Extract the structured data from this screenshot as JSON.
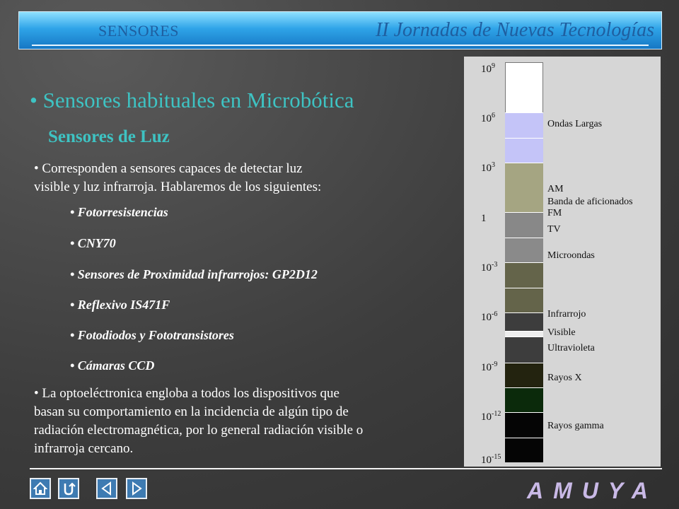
{
  "header": {
    "section": "SENSORES",
    "event": "II Jornadas de Nuevas Tecnologías"
  },
  "heading": "• Sensores habituales en Microbótica",
  "subheading": "Sensores de Luz",
  "intro_line1": "• Corresponden a sensores capaces de detectar luz",
  "intro_line2": "visible y luz infrarroja. Hablaremos de los siguientes:",
  "items": [
    "• Fotorresistencias",
    "• CNY70",
    "• Sensores de Proximidad infrarrojos: GP2D12",
    "• Reflexivo  IS471F",
    "• Fotodiodos y Fototransistores",
    "• Cámaras CCD"
  ],
  "conclusion": [
    "• La optoeléctronica engloba a todos los dispositivos que",
    "basan su comportamiento en la incidencia de algún tipo de",
    "radiación electromagnética, por lo general radiación visible o",
    "infrarroja cercano."
  ],
  "spectrum": {
    "ticks": [
      {
        "base": "10",
        "exp": "9"
      },
      {
        "base": "10",
        "exp": "6"
      },
      {
        "base": "10",
        "exp": "3"
      },
      {
        "base": "1",
        "exp": ""
      },
      {
        "base": "10",
        "exp": "-3"
      },
      {
        "base": "10",
        "exp": "-6"
      },
      {
        "base": "10",
        "exp": "-9"
      },
      {
        "base": "10",
        "exp": "-12"
      },
      {
        "base": "10",
        "exp": "-15"
      }
    ],
    "labels": [
      "Ondas Largas",
      "AM",
      "Banda de aficionados",
      "FM",
      "TV",
      "Microondas",
      "Infrarrojo",
      "Visible",
      "Ultravioleta",
      "Rayos X",
      "Rayos gamma"
    ],
    "colors": {
      "ondas_largas": "#c4c4f8",
      "am": "#a5a582",
      "fm_tv": "#888888",
      "microondas": "#8a8a8a",
      "infrarrojo": "#64644a",
      "dark_gray": "#3d3d3d",
      "visible": "#eeeeee",
      "rayos_x": "#23230f",
      "green": "#0b2a0b",
      "gamma": "#050505"
    }
  },
  "nav": {
    "icons": [
      "home-icon",
      "return-icon",
      "previous-icon",
      "next-icon"
    ]
  },
  "logo": "AMUYA"
}
